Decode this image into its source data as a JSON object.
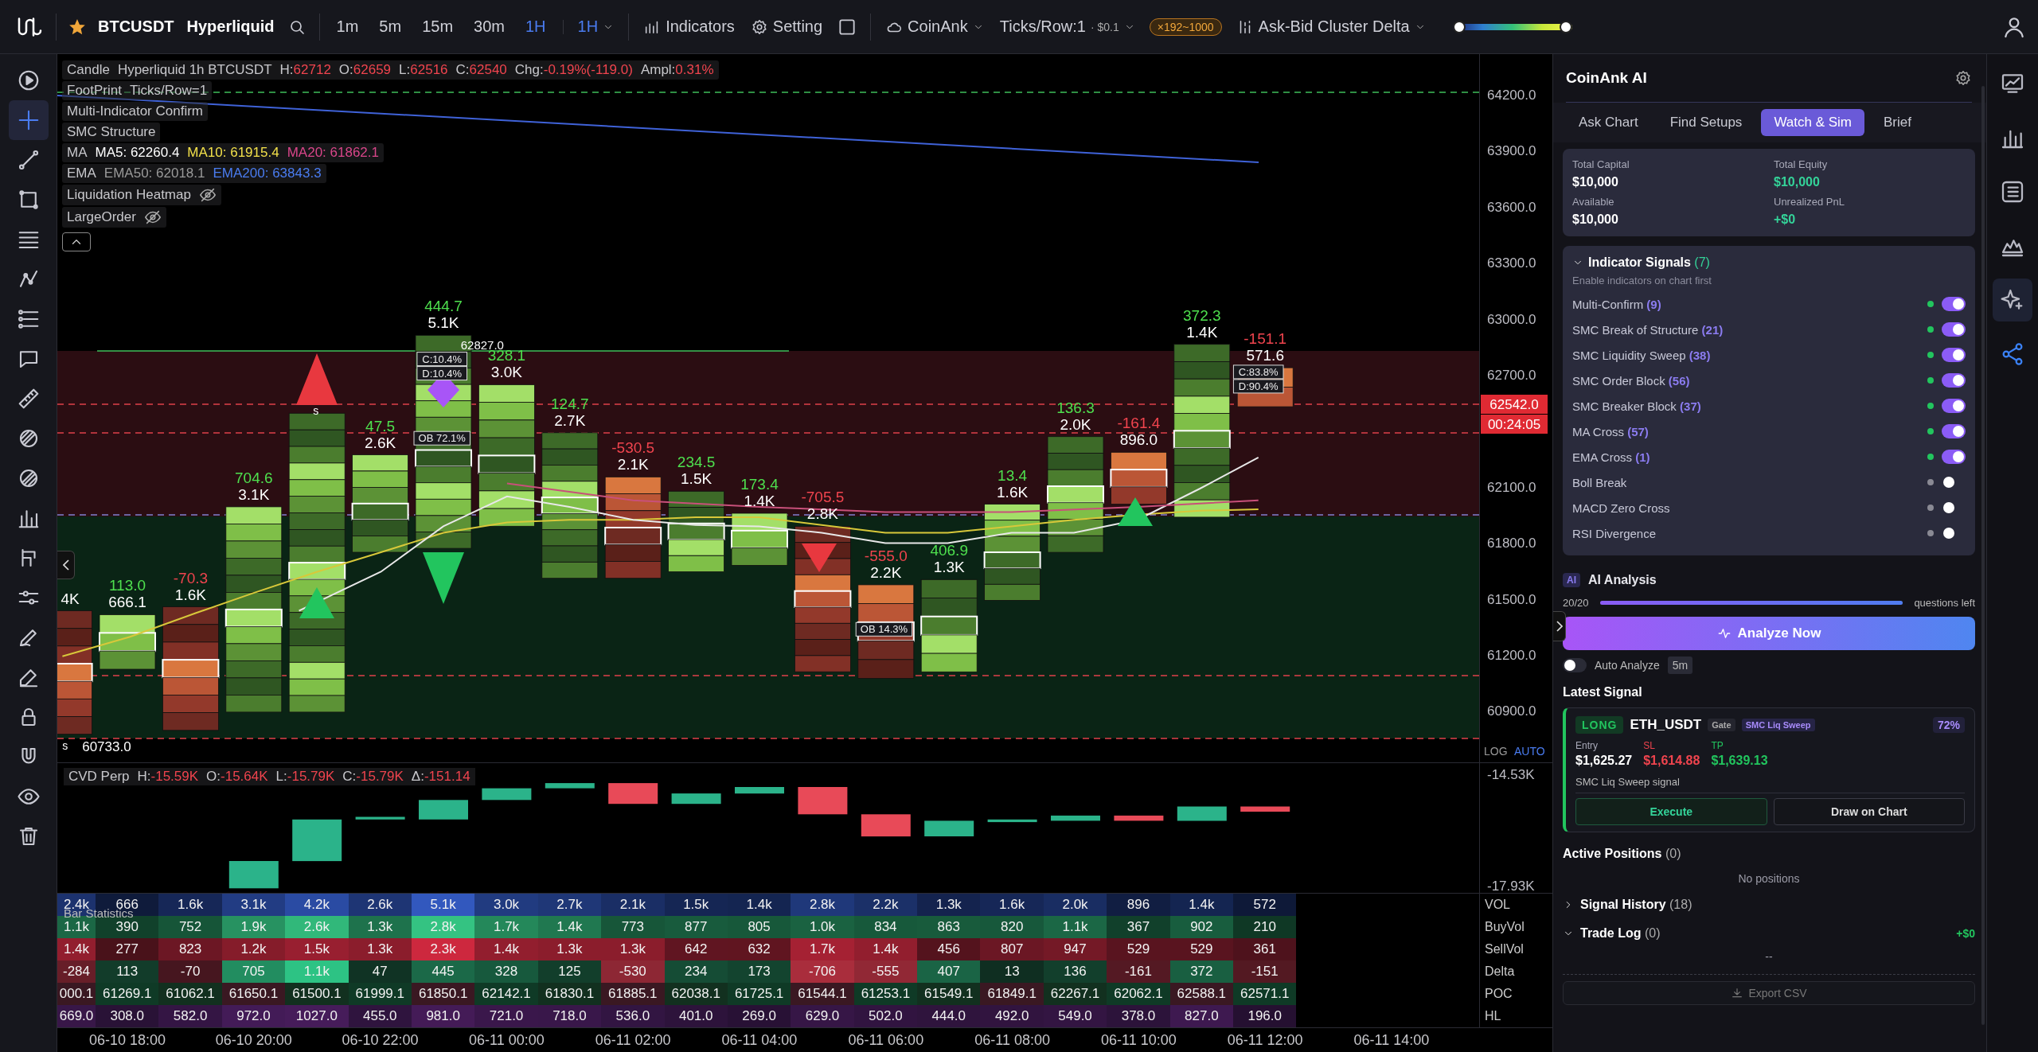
{
  "topbar": {
    "favorite": true,
    "symbol": "BTCUSDT",
    "exchange": "Hyperliquid",
    "intervals": [
      {
        "label": "1m",
        "selected": false
      },
      {
        "label": "5m",
        "selected": false
      },
      {
        "label": "15m",
        "selected": false
      },
      {
        "label": "30m",
        "selected": false
      },
      {
        "label": "1H",
        "selected": true
      }
    ],
    "interval_dropdown": "1H",
    "indicators": "Indicators",
    "setting": "Setting",
    "source": "CoinAnk",
    "ticks": "Ticks/Row:1",
    "tick_size": "· $0.1",
    "multiplier": "×192~1000",
    "mode": "Ask-Bid Cluster Delta",
    "heat_slider": [
      {
        "level": 0
      },
      {
        "level": 1
      }
    ]
  },
  "drawing_tools": [
    {
      "selected": false
    },
    {
      "selected": true
    },
    {
      "selected": false
    },
    {
      "selected": false
    },
    {
      "selected": false
    },
    {
      "selected": false
    },
    {
      "selected": false
    },
    {
      "selected": false
    },
    {
      "selected": false
    },
    {
      "selected": false
    },
    {
      "selected": false
    },
    {
      "selected": false
    },
    {
      "selected": false
    },
    {
      "selected": false
    },
    {
      "selected": false
    },
    {
      "selected": false
    },
    {
      "selected": false
    },
    {
      "selected": false
    },
    {
      "selected": false
    },
    {
      "selected": false
    }
  ],
  "legend": [
    {
      "kind": "candle",
      "name": "Candle",
      "detail": "Hyperliquid 1h BTCUSDT",
      "fields": [
        {
          "label": "H:",
          "value": "62712"
        },
        {
          "label": "O:",
          "value": "62659"
        },
        {
          "label": "L:",
          "value": "62516"
        },
        {
          "label": "C:",
          "value": "62540"
        },
        {
          "label": "Chg:",
          "value": "-0.19%(-119.0)"
        },
        {
          "label": "Ampl:",
          "value": "0.31%"
        }
      ]
    },
    {
      "kind": "text",
      "name": "FootPrint",
      "detail": "Ticks/Row=1"
    },
    {
      "kind": "text",
      "name": "Multi-Indicator Confirm"
    },
    {
      "kind": "text",
      "name": "SMC Structure"
    },
    {
      "kind": "values",
      "name": "MA",
      "values": [
        {
          "text": "MA5: 62260.4",
          "color": "#ffffff"
        },
        {
          "text": "MA10: 61915.4",
          "color": "#f2e04a"
        },
        {
          "text": "MA20: 61862.1",
          "color": "#d9468a"
        }
      ]
    },
    {
      "kind": "values",
      "name": "EMA",
      "values": [
        {
          "text": "EMA50: 62018.1",
          "color": "#9a9a9a"
        },
        {
          "text": "EMA200: 63843.3",
          "color": "#4a7cf0"
        }
      ]
    },
    {
      "kind": "hidden",
      "name": "Liquidation Heatmap"
    },
    {
      "kind": "hidden",
      "name": "LargeOrder"
    }
  ],
  "price_axis": [
    "64200.0",
    "63900.0",
    "63600.0",
    "63300.0",
    "63000.0",
    "62700.0",
    "62100.0",
    "61800.0",
    "61500.0",
    "61200.0",
    "60900.0"
  ],
  "current_price": {
    "price": "62542.0",
    "countdown": "00:24:05"
  },
  "scale_modes": [
    {
      "label": "LOG",
      "selected": false
    },
    {
      "label": "AUTO",
      "selected": true
    }
  ],
  "candles": [
    {
      "kind": "down",
      "volume": "4K"
    },
    {
      "kind": "up",
      "delta": "113.0",
      "volume": "666.1"
    },
    {
      "kind": "down",
      "delta": "-70.3",
      "volume": "1.6K"
    },
    {
      "kind": "up",
      "delta": "704.6",
      "volume": "3.1K"
    },
    {
      "kind": "up"
    },
    {
      "kind": "up",
      "delta": "47.5",
      "volume": "2.6K"
    },
    {
      "kind": "up",
      "delta": "444.7",
      "volume": "5.1K"
    },
    {
      "kind": "up",
      "delta": "328.1",
      "volume": "3.0K"
    },
    {
      "kind": "up",
      "delta": "124.7",
      "volume": "2.7K"
    },
    {
      "kind": "down",
      "delta": "-530.5",
      "volume": "2.1K"
    },
    {
      "kind": "up",
      "delta": "234.5",
      "volume": "1.5K"
    },
    {
      "kind": "up",
      "delta": "173.4",
      "volume": "1.4K"
    },
    {
      "kind": "down",
      "delta": "-705.5",
      "volume": "2.8K"
    },
    {
      "kind": "down",
      "delta": "-555.0",
      "volume": "2.2K"
    },
    {
      "kind": "up",
      "delta": "406.9",
      "volume": "1.3K"
    },
    {
      "kind": "up",
      "delta": "13.4",
      "volume": "1.6K"
    },
    {
      "kind": "up",
      "delta": "136.3",
      "volume": "2.0K"
    },
    {
      "kind": "down",
      "delta": "-161.4",
      "volume": "896.0"
    },
    {
      "kind": "up",
      "delta": "372.3",
      "volume": "1.4K"
    },
    {
      "kind": "down",
      "delta": "-151.1",
      "volume": "571.6"
    }
  ],
  "annotations": [
    "62827.0",
    "C:10.4%",
    "D:10.4%",
    "OB 72.1%",
    "OB 14.3%",
    "C:83.8%",
    "D:90.4%",
    "60733.0",
    "s",
    "s"
  ],
  "cvd": {
    "title": "CVD Perp",
    "fields": [
      {
        "label": "H:",
        "value": "-15.59K"
      },
      {
        "label": "O:",
        "value": "-15.64K"
      },
      {
        "label": "L:",
        "value": "-15.79K"
      },
      {
        "label": "C:",
        "value": "-15.79K"
      },
      {
        "label": "Δ:",
        "value": "-151.14"
      }
    ],
    "axis": [
      "-14.53K",
      "-17.93K"
    ]
  },
  "bar_statistics": {
    "title": "Bar Statistics",
    "rows": [
      {
        "kind": "volume",
        "label": "VOL",
        "cells": [
          "2.4k",
          "666",
          "1.6k",
          "3.1k",
          "4.2k",
          "2.6k",
          "5.1k",
          "3.0k",
          "2.7k",
          "2.1k",
          "1.5k",
          "1.4k",
          "2.8k",
          "2.2k",
          "1.3k",
          "1.6k",
          "2.0k",
          "896",
          "1.4k",
          "572"
        ]
      },
      {
        "kind": "buy",
        "label": "BuyVol",
        "cells": [
          "1.1k",
          "390",
          "752",
          "1.9k",
          "2.6k",
          "1.3k",
          "2.8k",
          "1.7k",
          "1.4k",
          "773",
          "877",
          "805",
          "1.0k",
          "834",
          "863",
          "820",
          "1.1k",
          "367",
          "902",
          "210"
        ]
      },
      {
        "kind": "sell",
        "label": "SellVol",
        "cells": [
          "1.4k",
          "277",
          "823",
          "1.2k",
          "1.5k",
          "1.3k",
          "2.3k",
          "1.4k",
          "1.3k",
          "1.3k",
          "642",
          "632",
          "1.7k",
          "1.4k",
          "456",
          "807",
          "947",
          "529",
          "529",
          "361"
        ]
      },
      {
        "kind": "delta",
        "label": "Delta",
        "cells": [
          "-284",
          "113",
          "-70",
          "705",
          "1.1k",
          "47",
          "445",
          "328",
          "125",
          "-530",
          "234",
          "173",
          "-706",
          "-555",
          "407",
          "13",
          "136",
          "-161",
          "372",
          "-151"
        ]
      },
      {
        "kind": "poc",
        "label": "POC",
        "cells": [
          "000.1",
          "61269.1",
          "61062.1",
          "61650.1",
          "61500.1",
          "61999.1",
          "61850.1",
          "62142.1",
          "61830.1",
          "61885.1",
          "62038.1",
          "61725.1",
          "61544.1",
          "61253.1",
          "61549.1",
          "61849.1",
          "62267.1",
          "62062.1",
          "62588.1",
          "62571.1"
        ]
      },
      {
        "kind": "range",
        "label": "HL",
        "cells": [
          "669.0",
          "308.0",
          "582.0",
          "972.0",
          "1027.0",
          "455.0",
          "981.0",
          "721.0",
          "718.0",
          "536.0",
          "401.0",
          "269.0",
          "629.0",
          "502.0",
          "444.0",
          "492.0",
          "549.0",
          "378.0",
          "827.0",
          "196.0"
        ]
      }
    ]
  },
  "time_axis": [
    "06-10 18:00",
    "06-10 20:00",
    "06-10 22:00",
    "06-11 00:00",
    "06-11 02:00",
    "06-11 04:00",
    "06-11 06:00",
    "06-11 08:00",
    "06-11 10:00",
    "06-11 12:00",
    "06-11 14:00"
  ],
  "panel": {
    "title": "CoinAnk AI",
    "tabs": [
      {
        "label": "Ask Chart",
        "selected": false
      },
      {
        "label": "Find Setups",
        "selected": false
      },
      {
        "label": "Watch & Sim",
        "selected": true
      },
      {
        "label": "Brief",
        "selected": false
      }
    ],
    "account": [
      {
        "label": "Total Capital",
        "value": "$10,000",
        "kind": "neutral"
      },
      {
        "label": "Total Equity",
        "value": "$10,000",
        "kind": "positive"
      },
      {
        "label": "Available",
        "value": "$10,000",
        "kind": "neutral"
      },
      {
        "label": "Unrealized PnL",
        "value": "+$0",
        "kind": "positive"
      }
    ],
    "indicator_signals": {
      "title": "Indicator Signals",
      "count": "(7)",
      "expanded": true,
      "hint": "Enable indicators on chart first",
      "items": [
        {
          "name": "Multi-Confirm",
          "count": "(9)",
          "enabled": true
        },
        {
          "name": "SMC Break of Structure",
          "count": "(21)",
          "enabled": true
        },
        {
          "name": "SMC Liquidity Sweep",
          "count": "(38)",
          "enabled": true
        },
        {
          "name": "SMC Order Block",
          "count": "(56)",
          "enabled": true
        },
        {
          "name": "SMC Breaker Block",
          "count": "(37)",
          "enabled": true
        },
        {
          "name": "MA Cross",
          "count": "(57)",
          "enabled": true
        },
        {
          "name": "EMA Cross",
          "count": "(1)",
          "enabled": true
        },
        {
          "name": "Boll Break",
          "enabled": false
        },
        {
          "name": "MACD Zero Cross",
          "enabled": false
        },
        {
          "name": "RSI Divergence",
          "enabled": false
        }
      ]
    },
    "ai_analysis": {
      "badge": "AI",
      "title": "AI Analysis",
      "quota": "20/20",
      "level": 1,
      "quota_note": "questions left",
      "button": "Analyze Now",
      "auto_label": "Auto Analyze",
      "auto_on": false,
      "interval": "5m"
    },
    "latest_signal": {
      "title": "Latest Signal",
      "side": "LONG",
      "kind": "long",
      "symbol": "ETH_USDT",
      "exchange": "Gate",
      "strategy": "SMC Liq Sweep",
      "confidence": "72%",
      "prices": [
        {
          "label": "Entry",
          "value": "$1,625.27",
          "kind": "entry"
        },
        {
          "label": "SL",
          "value": "$1,614.88",
          "kind": "stop"
        },
        {
          "label": "TP",
          "value": "$1,639.13",
          "kind": "target"
        }
      ],
      "note": "SMC Liq Sweep signal",
      "actions": [
        "Execute",
        "Draw on Chart"
      ]
    },
    "active_positions": {
      "title": "Active Positions",
      "count": "(0)",
      "empty": "No positions"
    },
    "signal_history": {
      "title": "Signal History",
      "count": "(18)",
      "expanded": false
    },
    "trade_log": {
      "title": "Trade Log",
      "count": "(0)",
      "expanded": true,
      "pnl": "+$0",
      "empty": "--"
    },
    "export": "Export CSV"
  },
  "side_tabs": [
    {
      "selected": false
    },
    {
      "selected": false
    },
    {
      "selected": false
    },
    {
      "selected": false
    },
    {
      "selected": true
    },
    {
      "selected": false
    }
  ]
}
